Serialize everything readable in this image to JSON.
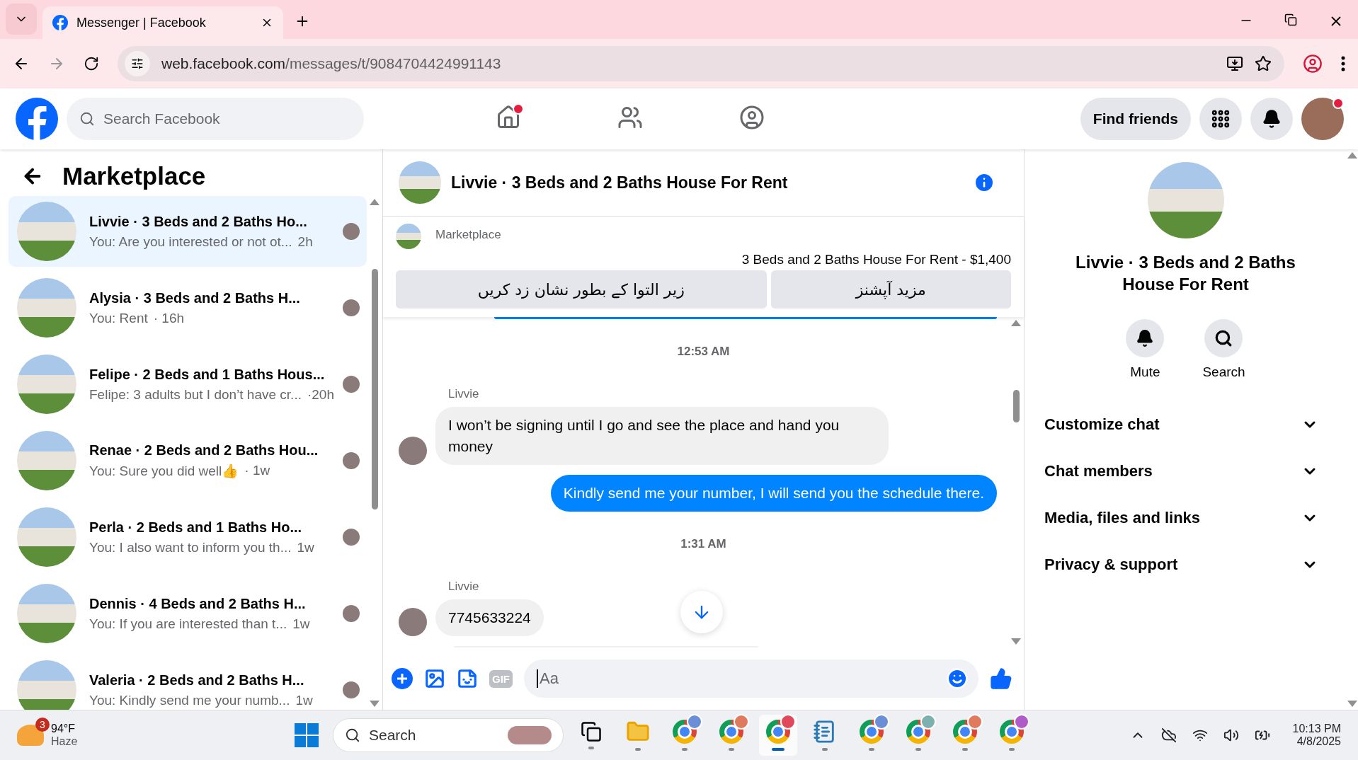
{
  "browser": {
    "tab_title": "Messenger | Facebook",
    "url_domain": "web.facebook.com",
    "url_path": "/messages/t/9084704424991143"
  },
  "header": {
    "search_placeholder": "Search Facebook",
    "nav": [
      {
        "kind": "home",
        "selected": false,
        "notification": true
      },
      {
        "kind": "friends",
        "selected": false,
        "notification": false
      },
      {
        "kind": "groups",
        "selected": false,
        "notification": false
      }
    ],
    "find_friends": "Find friends",
    "avatar_notification": true
  },
  "sidebar": {
    "title": "Marketplace",
    "conversations": [
      {
        "title": "Livvie · 3 Beds and 2 Baths Ho...",
        "preview": "You: Are you interested or not ot...",
        "time": "2h",
        "selected": true
      },
      {
        "title": "Alysia · 3 Beds and 2 Baths H...",
        "preview": "You: Rent",
        "time": "· 16h",
        "selected": false
      },
      {
        "title": "Felipe · 2 Beds and 1 Baths Hous...",
        "preview": "Felipe: 3 adults but I don’t have cr...",
        "time": "·20h",
        "selected": false
      },
      {
        "title": "Renae · 2 Beds and 2 Baths Hou...",
        "preview": "You: Sure you did well👍",
        "time": "· 1w",
        "selected": false
      },
      {
        "title": "Perla · 2 Beds and 1 Baths Ho...",
        "preview": "You: I also want to inform you th...",
        "time": "1w",
        "selected": false
      },
      {
        "title": "Dennis · 4 Beds and 2 Baths H...",
        "preview": "You: If you are interested than t...",
        "time": "1w",
        "selected": false
      },
      {
        "title": "Valeria · 2 Beds and 2 Baths H...",
        "preview": "You: Kindly send me your numb...",
        "time": "1w",
        "selected": false
      }
    ]
  },
  "chat": {
    "title": "Livvie · 3 Beds and 2 Baths House For Rent",
    "listing": {
      "label": "Marketplace",
      "title": "3 Beds and 2 Baths House For Rent - $1,400",
      "actions": [
        "مزید آپشنز",
        "زیر التوا کے بطور نشان زد کریں"
      ]
    },
    "messages": [
      {
        "kind": "timestamp",
        "text": "12:53 AM"
      },
      {
        "kind": "incoming",
        "sender": "Livvie",
        "text": "I won’t be signing until I go and see the place and hand you money"
      },
      {
        "kind": "outgoing",
        "text": "Kindly send me your number, I will send you the schedule there."
      },
      {
        "kind": "timestamp",
        "text": "1:31 AM"
      },
      {
        "kind": "incoming",
        "sender": "Livvie",
        "text": "7745633224"
      }
    ],
    "composer": {
      "gif": "GIF",
      "placeholder": "Aa"
    }
  },
  "details": {
    "title": "Livvie · 3 Beds and 2 Baths House For Rent",
    "actions": [
      {
        "kind": "mute",
        "label": "Mute"
      },
      {
        "kind": "search",
        "label": "Search"
      }
    ],
    "sections": [
      {
        "label": "Customize chat",
        "expanded": false
      },
      {
        "label": "Chat members",
        "expanded": false
      },
      {
        "label": "Media, files and links",
        "expanded": false
      },
      {
        "label": "Privacy & support",
        "expanded": false
      }
    ]
  },
  "taskbar": {
    "weather": {
      "badge": "3",
      "temperature": "94°F",
      "condition": "Haze"
    },
    "search_placeholder": "Search",
    "apps": [
      {
        "kind": "task-view",
        "selected": false
      },
      {
        "kind": "files",
        "selected": false
      },
      {
        "kind": "chrome",
        "color": "#6b8fd6",
        "selected": false
      },
      {
        "kind": "chrome",
        "color": "#e07a5f",
        "selected": false
      },
      {
        "kind": "chrome",
        "color": "#e0485c",
        "selected": true
      },
      {
        "kind": "notepad",
        "selected": false
      },
      {
        "kind": "chrome",
        "color": "#6b8fd6",
        "selected": false
      },
      {
        "kind": "chrome",
        "color": "#7fb0b0",
        "selected": false
      },
      {
        "kind": "chrome",
        "color": "#e07a5f",
        "selected": false
      },
      {
        "kind": "chrome",
        "color": "#b05cc8",
        "selected": false
      }
    ],
    "time": "10:13 PM",
    "date": "4/8/2025"
  }
}
